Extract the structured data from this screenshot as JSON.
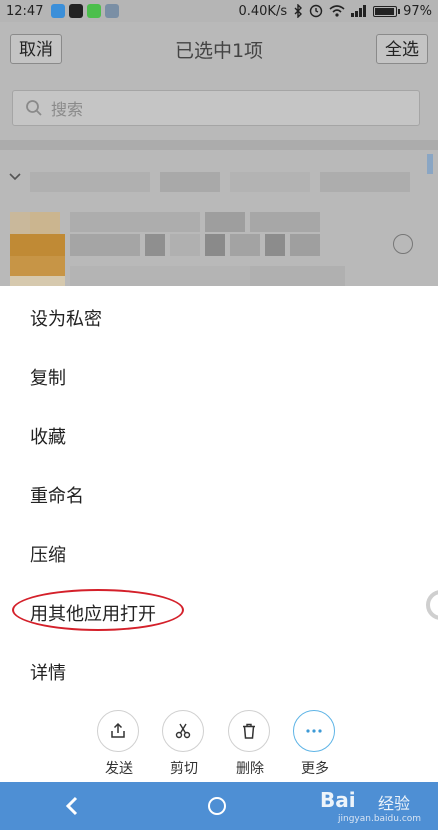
{
  "status": {
    "time": "12:47",
    "speed": "0.40K/s",
    "battery": "97%",
    "battery_fraction": 0.97
  },
  "header": {
    "cancel_label": "取消",
    "title": "已选中1项",
    "select_all_label": "全选"
  },
  "search": {
    "placeholder": "搜索"
  },
  "menu": {
    "items": [
      "设为私密",
      "复制",
      "收藏",
      "重命名",
      "压缩",
      "用其他应用打开",
      "详情"
    ]
  },
  "actions": [
    {
      "label": "发送",
      "icon": "share-icon"
    },
    {
      "label": "剪切",
      "icon": "scissors-icon"
    },
    {
      "label": "删除",
      "icon": "trash-icon"
    },
    {
      "label": "更多",
      "icon": "more-dots-icon"
    }
  ],
  "watermark": {
    "logo": "Bai",
    "text": "经验",
    "url": "jingyan.baidu.com"
  },
  "colors": {
    "accent": "#4e8fd4",
    "highlight_circle": "#d4202a",
    "more_ring": "#5eb4e6"
  }
}
